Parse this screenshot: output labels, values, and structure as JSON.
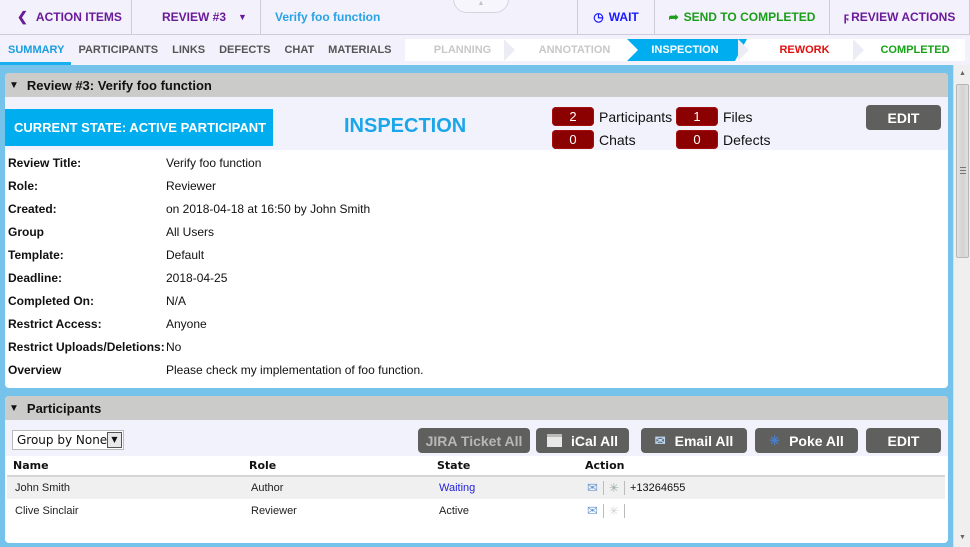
{
  "topbar": {
    "back_label": "ACTION ITEMS",
    "review_label": "REVIEW #3",
    "title": "Verify foo function",
    "wait_label": "WAIT",
    "send_label": "SEND TO COMPLETED",
    "actions_label": "REVIEW ACTIONS"
  },
  "tabs": [
    {
      "label": "SUMMARY",
      "active": true
    },
    {
      "label": "PARTICIPANTS"
    },
    {
      "label": "LINKS"
    },
    {
      "label": "DEFECTS"
    },
    {
      "label": "CHAT"
    },
    {
      "label": "MATERIALS"
    }
  ],
  "stages": [
    {
      "label": "PLANNING",
      "status": "done"
    },
    {
      "label": "ANNOTATION",
      "status": "done"
    },
    {
      "label": "INSPECTION",
      "status": "current"
    },
    {
      "label": "REWORK",
      "status": "pending"
    },
    {
      "label": "COMPLETED",
      "status": "pending"
    }
  ],
  "summary": {
    "header": "Review #3: Verify foo function",
    "state_badge": "CURRENT STATE: ACTIVE PARTICIPANT",
    "phase": "INSPECTION",
    "counters": {
      "participants": {
        "value": "2",
        "label": "Participants"
      },
      "files": {
        "value": "1",
        "label": "Files"
      },
      "chats": {
        "value": "0",
        "label": "Chats"
      },
      "defects": {
        "value": "0",
        "label": "Defects"
      }
    },
    "edit_label": "EDIT",
    "fields": [
      {
        "label": "Review Title:",
        "value": "Verify foo function"
      },
      {
        "label": "Role:",
        "value": "Reviewer"
      },
      {
        "label": "Created:",
        "value": "on 2018-04-18 at 16:50 by John Smith"
      },
      {
        "label": "Group",
        "value": "All Users"
      },
      {
        "label": "Template:",
        "value": "Default"
      },
      {
        "label": "Deadline:",
        "value": "2018-04-25"
      },
      {
        "label": "Completed On:",
        "value": "N/A"
      },
      {
        "label": "Restrict Access:",
        "value": "Anyone"
      },
      {
        "label": "Restrict Uploads/Deletions:",
        "value": "No"
      },
      {
        "label": "Overview",
        "value": "Please check my implementation of foo function."
      }
    ]
  },
  "participants": {
    "header": "Participants",
    "group_by": "Group by None",
    "buttons": {
      "jira": "JIRA Ticket All",
      "ical": "iCal All",
      "email": "Email All",
      "poke": "Poke All",
      "edit": "EDIT"
    },
    "columns": [
      "Name",
      "Role",
      "State",
      "Action"
    ],
    "rows": [
      {
        "name": "John Smith",
        "role": "Author",
        "state": "Waiting",
        "phone": "+13264655"
      },
      {
        "name": "Clive Sinclair",
        "role": "Reviewer",
        "state": "Active",
        "phone": ""
      }
    ]
  }
}
